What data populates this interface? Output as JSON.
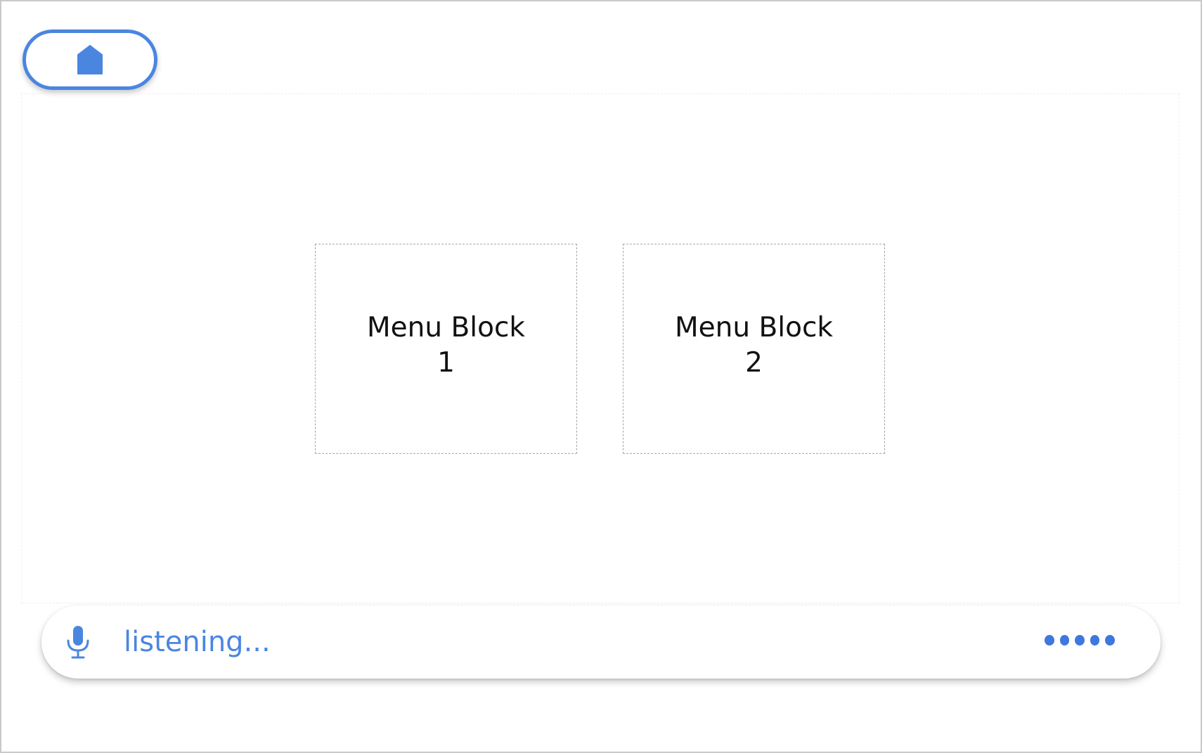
{
  "header": {
    "home_button_icon": "home-icon"
  },
  "menu": {
    "blocks": [
      {
        "label": "Menu Block\n1"
      },
      {
        "label": "Menu Block\n2"
      }
    ]
  },
  "voice_bar": {
    "mic_icon": "microphone-icon",
    "status_text": "listening...",
    "indicator": "five-dots-icon",
    "accent_color": "#4a86e0"
  }
}
